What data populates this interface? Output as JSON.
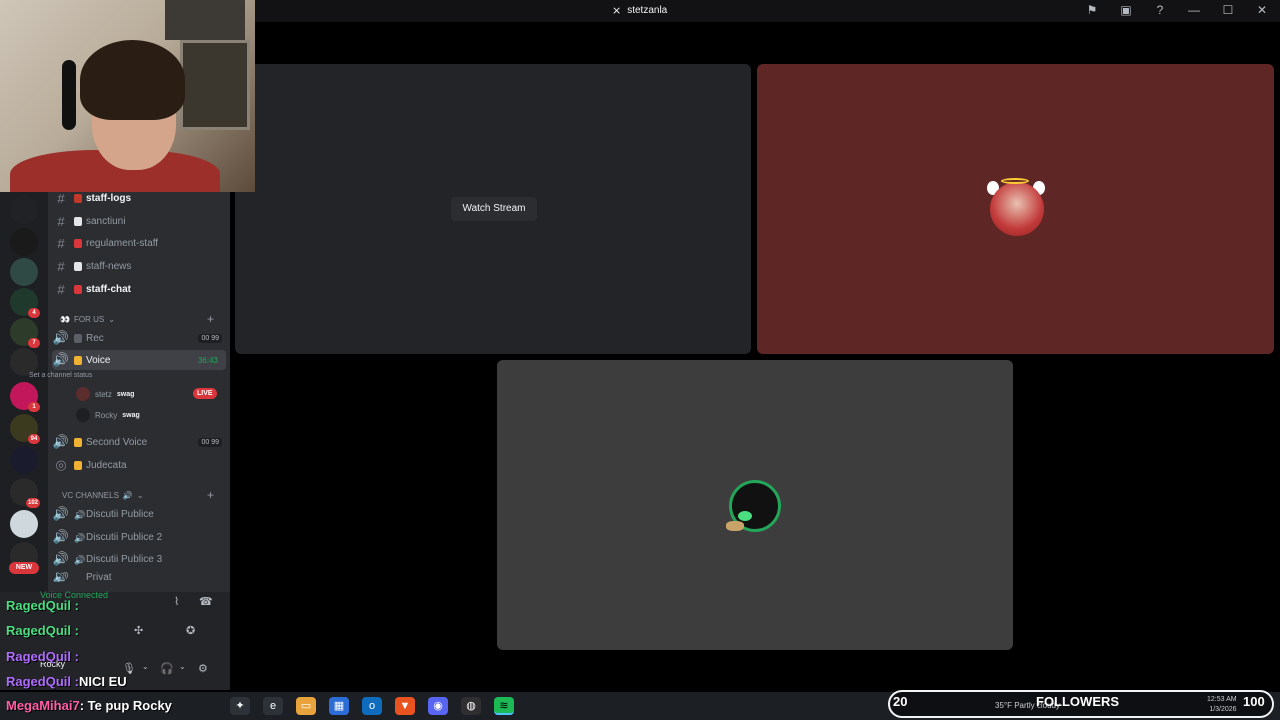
{
  "window": {
    "title": "stetzanla"
  },
  "title_icons": [
    "flag-icon",
    "inbox-icon",
    "help-icon",
    "minimize-icon",
    "maximize-icon",
    "close-icon"
  ],
  "server_badges": [
    "4",
    "7",
    "1",
    "94",
    "102"
  ],
  "new_badge": "NEW",
  "channels": {
    "text": [
      {
        "name": "staff-logs",
        "bright": true
      },
      {
        "name": "sanctiuni",
        "bright": false
      },
      {
        "name": "regulament-staff",
        "bright": false
      },
      {
        "name": "staff-news",
        "bright": false
      },
      {
        "name": "staff-chat",
        "bright": true
      }
    ],
    "category_for_us": "FOR US",
    "rec": {
      "name": "Rec",
      "tag": "00 99"
    },
    "voice": {
      "name": "Voice",
      "status": "Set a channel status",
      "timer": "36:43"
    },
    "members": [
      {
        "name": "stetz",
        "tag": "swag"
      },
      {
        "name": "Rocky",
        "tag": "swag"
      }
    ],
    "live_label": "LIVE",
    "second_voice": {
      "name": "Second Voice",
      "tag": "00 99"
    },
    "judecata": "Judecata",
    "category_vc": "VC CHANNELS",
    "vc_list": [
      "Discutii Publice",
      "Discutii Publice 2",
      "Discutii Publice 3",
      "Privat"
    ]
  },
  "user_panel": {
    "voice_connected": "Voice Connected",
    "username": "Rocky"
  },
  "chat_overlay": [
    {
      "user": "RagedQuil :",
      "msg": "",
      "color": "#4ade80"
    },
    {
      "user": "RagedQuil :",
      "msg": "",
      "color": "#4ade80"
    },
    {
      "user": "RagedQuil :",
      "msg": "",
      "color": "#b06bff"
    },
    {
      "user": "RagedQuil :",
      "msg": "NICI EU",
      "color": "#b06bff"
    }
  ],
  "ticker": {
    "user": "MegaMihai7",
    "msg": ": Te pup Rocky"
  },
  "stream": {
    "watch_label": "Watch Stream"
  },
  "taskbar": {
    "apps": [
      "copilot",
      "edge",
      "explorer",
      "store",
      "outlook",
      "brave",
      "discord",
      "obs",
      "spotify"
    ],
    "followers_count": "20",
    "followers_label": "FOLLOWERS",
    "followers_goal": "100",
    "weather": "35°F Partly cloudy",
    "time": "12:53 AM",
    "date": "1/3/2026"
  }
}
